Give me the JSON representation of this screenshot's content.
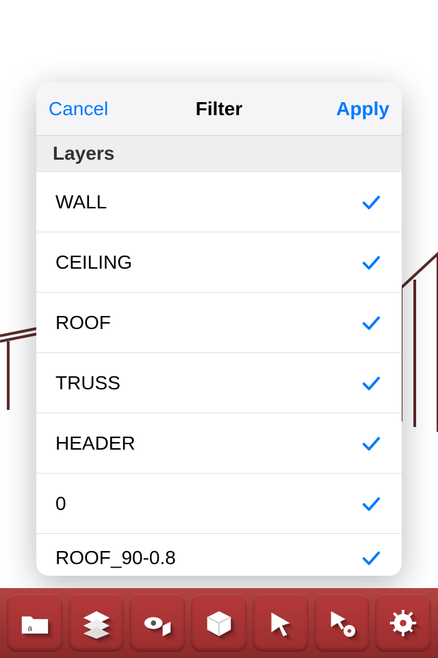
{
  "filter_sheet": {
    "cancel_label": "Cancel",
    "title": "Filter",
    "apply_label": "Apply",
    "section": "Layers",
    "layers": [
      {
        "name": "WALL",
        "checked": true
      },
      {
        "name": "CEILING",
        "checked": true
      },
      {
        "name": "ROOF",
        "checked": true
      },
      {
        "name": "TRUSS",
        "checked": true
      },
      {
        "name": "HEADER",
        "checked": true
      },
      {
        "name": "0",
        "checked": true
      },
      {
        "name": "ROOF_90-0.8",
        "checked": true
      }
    ]
  },
  "toolbar": {
    "icons": [
      "open-folder-icon",
      "layers-icon",
      "view-icon",
      "cube-icon",
      "select-icon",
      "select-settings-icon",
      "settings-icon"
    ]
  },
  "colors": {
    "accent": "#007aff",
    "toolbar_bg": "#9c2e2e"
  }
}
